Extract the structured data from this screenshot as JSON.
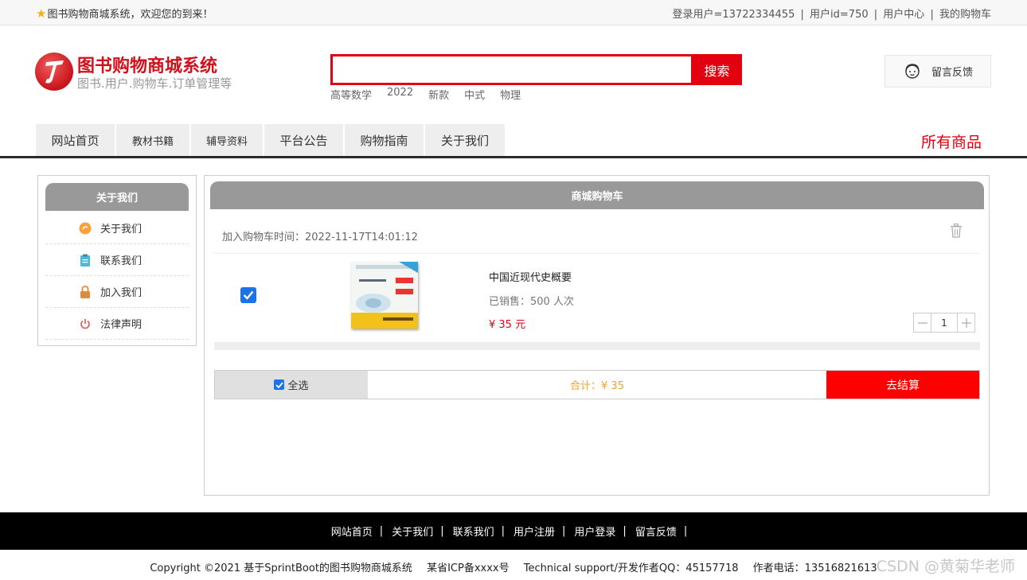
{
  "topbar": {
    "welcome": "图书购物商城系统，欢迎您的到来！",
    "login_user": "登录用户=13722334455",
    "user_id": "用户id=750",
    "user_center": "用户中心",
    "my_cart": "我的购物车",
    "separator": "|"
  },
  "header": {
    "title": "图书购物商城系统",
    "subtitle": "图书.用户.购物车.订单管理等",
    "search_value": "",
    "search_button": "搜索",
    "hotwords": [
      "高等数学",
      "2022",
      "新款",
      "中式",
      "物理"
    ],
    "feedback": "留言反馈"
  },
  "nav": {
    "items": [
      "网站首页",
      "教材书籍",
      "辅导资料",
      "平台公告",
      "购物指南",
      "关于我们"
    ],
    "all_goods": "所有商品"
  },
  "sidebar": {
    "title": "关于我们",
    "items": [
      "关于我们",
      "联系我们",
      "加入我们",
      "法律声明"
    ]
  },
  "cart": {
    "title": "商城购物车",
    "add_time": "加入购物车时间：2022-11-17T14:01:12",
    "item": {
      "checked": true,
      "name": "中国近现代史概要",
      "sold": "已销售：500 人次",
      "price": "¥ 35 元",
      "quantity": "1"
    },
    "select_all": "全选",
    "total": "合计：¥ 35",
    "checkout": "去结算"
  },
  "footer": {
    "links": [
      "网站首页",
      "关于我们",
      "联系我们",
      "用户注册",
      "用户登录",
      "留言反馈"
    ],
    "separator": "|",
    "copyright": "Copyright ©2021 基于SprintBoot的图书购物商城系统",
    "icp": "某省ICP备xxxx号",
    "support": "Technical support/开发作者QQ：45157718",
    "phone": "作者电话：13516821613"
  },
  "watermark": "CSDN @黄菊华老师",
  "colors": {
    "brand_red": "#e3000f",
    "header_gray": "#999999",
    "checkbox_blue": "#1a73e8",
    "total_orange": "#f0a030"
  }
}
